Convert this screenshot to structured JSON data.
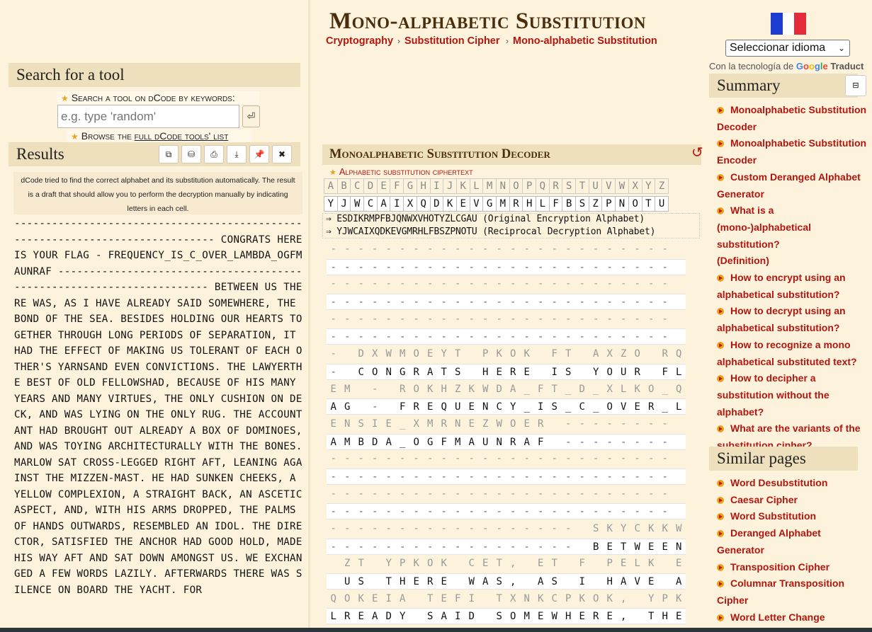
{
  "header": {
    "title": "Mono-alphabetic Substitution",
    "breadcrumb": [
      "Cryptography",
      "Substitution Cipher",
      "Mono-alphabetic Substitution"
    ]
  },
  "search": {
    "heading": "Search for a tool",
    "label": "Search a tool on dCode by keywords:",
    "placeholder": "e.g. type 'random'",
    "browse_prefix": "Browse the ",
    "browse_link": "full dCode tools' list"
  },
  "results": {
    "heading": "Results",
    "buttons": [
      "copy-icon",
      "save-icon",
      "print-icon",
      "download-icon",
      "pin-icon",
      "close-icon"
    ],
    "note": "dCode tried to find the correct alphabet and its substitution automatically. The result is a draft that should allow you to perform the decryption manually by indicating letters in each cell.",
    "text": "------------------------------------------------------------------------------ CONGRATS HERE IS YOUR FLAG - FREQUENCY_IS_C_OVER_LAMBDA_OGFMAUNRAF ---------------------------------------------------------------------- BETWEEN US THERE WAS, AS I HAVE ALREADY SAID SOMEWHERE, THE BOND OF THE SEA. BESIDES HOLDING OUR HEARTS TOGETHER THROUGH LONG PERIODS OF SEPARATION, IT HAD THE EFFECT OF MAKING US TOLERANT OF EACH OTHER'S YARNSAND EVEN CONVICTIONS. THE LAWYERTHE BEST OF OLD FELLOWSHAD, BECAUSE OF HIS MANY YEARS AND MANY VIRTUES, THE ONLY CUSHION ON DECK, AND WAS LYING ON THE ONLY RUG. THE ACCOUNTANT HAD BROUGHT OUT ALREADY A BOX OF DOMINOES, AND WAS TOYING ARCHITECTURALLY WITH THE BONES. MARLOW SAT CROSS-LEGGED RIGHT AFT, LEANING AGAINST THE MIZZEN-MAST. HE HAD SUNKEN CHEEKS, A YELLOW COMPLEXION, A STRAIGHT BACK, AN ASCETIC ASPECT, AND, WITH HIS ARMS DROPPED, THE PALMS OF HANDS OUTWARDS, RESEMBLED AN IDOL. THE DIRECTOR, SATISFIED THE ANCHOR HAD GOOD HOLD, MADE HIS WAY AFT AND SAT DOWN AMONGST US. WE EXCHANGED A FEW WORDS LAZILY. AFTERWARDS THERE WAS SILENCE ON BOARD THE YACHT. FOR"
  },
  "language": {
    "select_label": "Seleccionar idioma",
    "powered_prefix": "Con la tecnología de",
    "google": "Google",
    "translate": "Traduct"
  },
  "summary": {
    "heading": "Summary",
    "items": [
      "Monoalphabetic Substitution Decoder",
      "Monoalphabetic Substitution Encoder",
      "Custom Deranged Alphabet Generator",
      "What is a (mono-)alphabetical substitution? (Definition)",
      "How to encrypt using an alphabetical substitution?",
      "How to decrypt using an alphabetical substitution?",
      "How to recognize a mono alphabetical substituted text?",
      "How to decipher a substitution without the alphabet?",
      "What are the variants of the substitution cipher?"
    ]
  },
  "similar": {
    "heading": "Similar pages",
    "items": [
      "Word Desubstitution",
      "Caesar Cipher",
      "Word Substitution",
      "Deranged Alphabet Generator",
      "Transposition Cipher",
      "Columnar Transposition Cipher",
      "Word Letter Change"
    ]
  },
  "decoder": {
    "heading": "Monoalphabetic Substitution Decoder",
    "ciphertext_label": "Alphabetic substitution ciphertext",
    "alphabet_plain": [
      "A",
      "B",
      "C",
      "D",
      "E",
      "F",
      "G",
      "H",
      "I",
      "J",
      "K",
      "L",
      "M",
      "N",
      "O",
      "P",
      "Q",
      "R",
      "S",
      "T",
      "U",
      "V",
      "W",
      "X",
      "Y",
      "Z"
    ],
    "alphabet_key": [
      "Y",
      "J",
      "W",
      "C",
      "A",
      "I",
      "X",
      "Q",
      "D",
      "K",
      "E",
      "V",
      "G",
      "M",
      "R",
      "H",
      "L",
      "F",
      "B",
      "S",
      "Z",
      "P",
      "N",
      "O",
      "T",
      "U"
    ],
    "encryption_alphabet_line": "⇒ ESDIKRMPFBJQNWXVHOTYZLCGAU (Original Encryption Alphabet)",
    "decryption_alphabet_line": "⇒ YJWCAIXQDKEVGMRHLFBSZPNOTU (Reciprocal Decryption Alphabet)",
    "grid_rows": [
      {
        "top": "-------------------------",
        "bot": "-------------------------"
      },
      {
        "top": "-------------------------",
        "bot": "-------------------------"
      },
      {
        "top": "-------------------------",
        "bot": "-------------------------"
      },
      {
        "top": "- DXWMOEYT PKOK FT AXZO RQ",
        "bot": "- CONGRATS HERE IS YOUR FL"
      },
      {
        "top": "EM - ROKHZKWDA_FT_D_XLKO_Q",
        "bot": "AG - FREQUENCY_IS_C_OVER_L"
      },
      {
        "top": "ENSIE_XMRNEZWOER --------",
        "bot": "AMBDA_OGFMAUNRAF --------"
      },
      {
        "top": "-------------------------",
        "bot": "-------------------------"
      },
      {
        "top": "-------------------------",
        "bot": "-------------------------"
      },
      {
        "top": "------------------ SKYCKKW",
        "bot": "------------------ BETWEEN"
      },
      {
        "top": " ZT YPKOK CET, ET F PELK E",
        "bot": " US THERE WAS, AS I HAVE A"
      },
      {
        "top": "QOKEIA TEFI TXNKCPKOK, YPK",
        "bot": "LREADY SAID SOMEWHERE, THE"
      },
      {
        "top": "-------------------------",
        "bot": "-------------------------"
      }
    ]
  }
}
